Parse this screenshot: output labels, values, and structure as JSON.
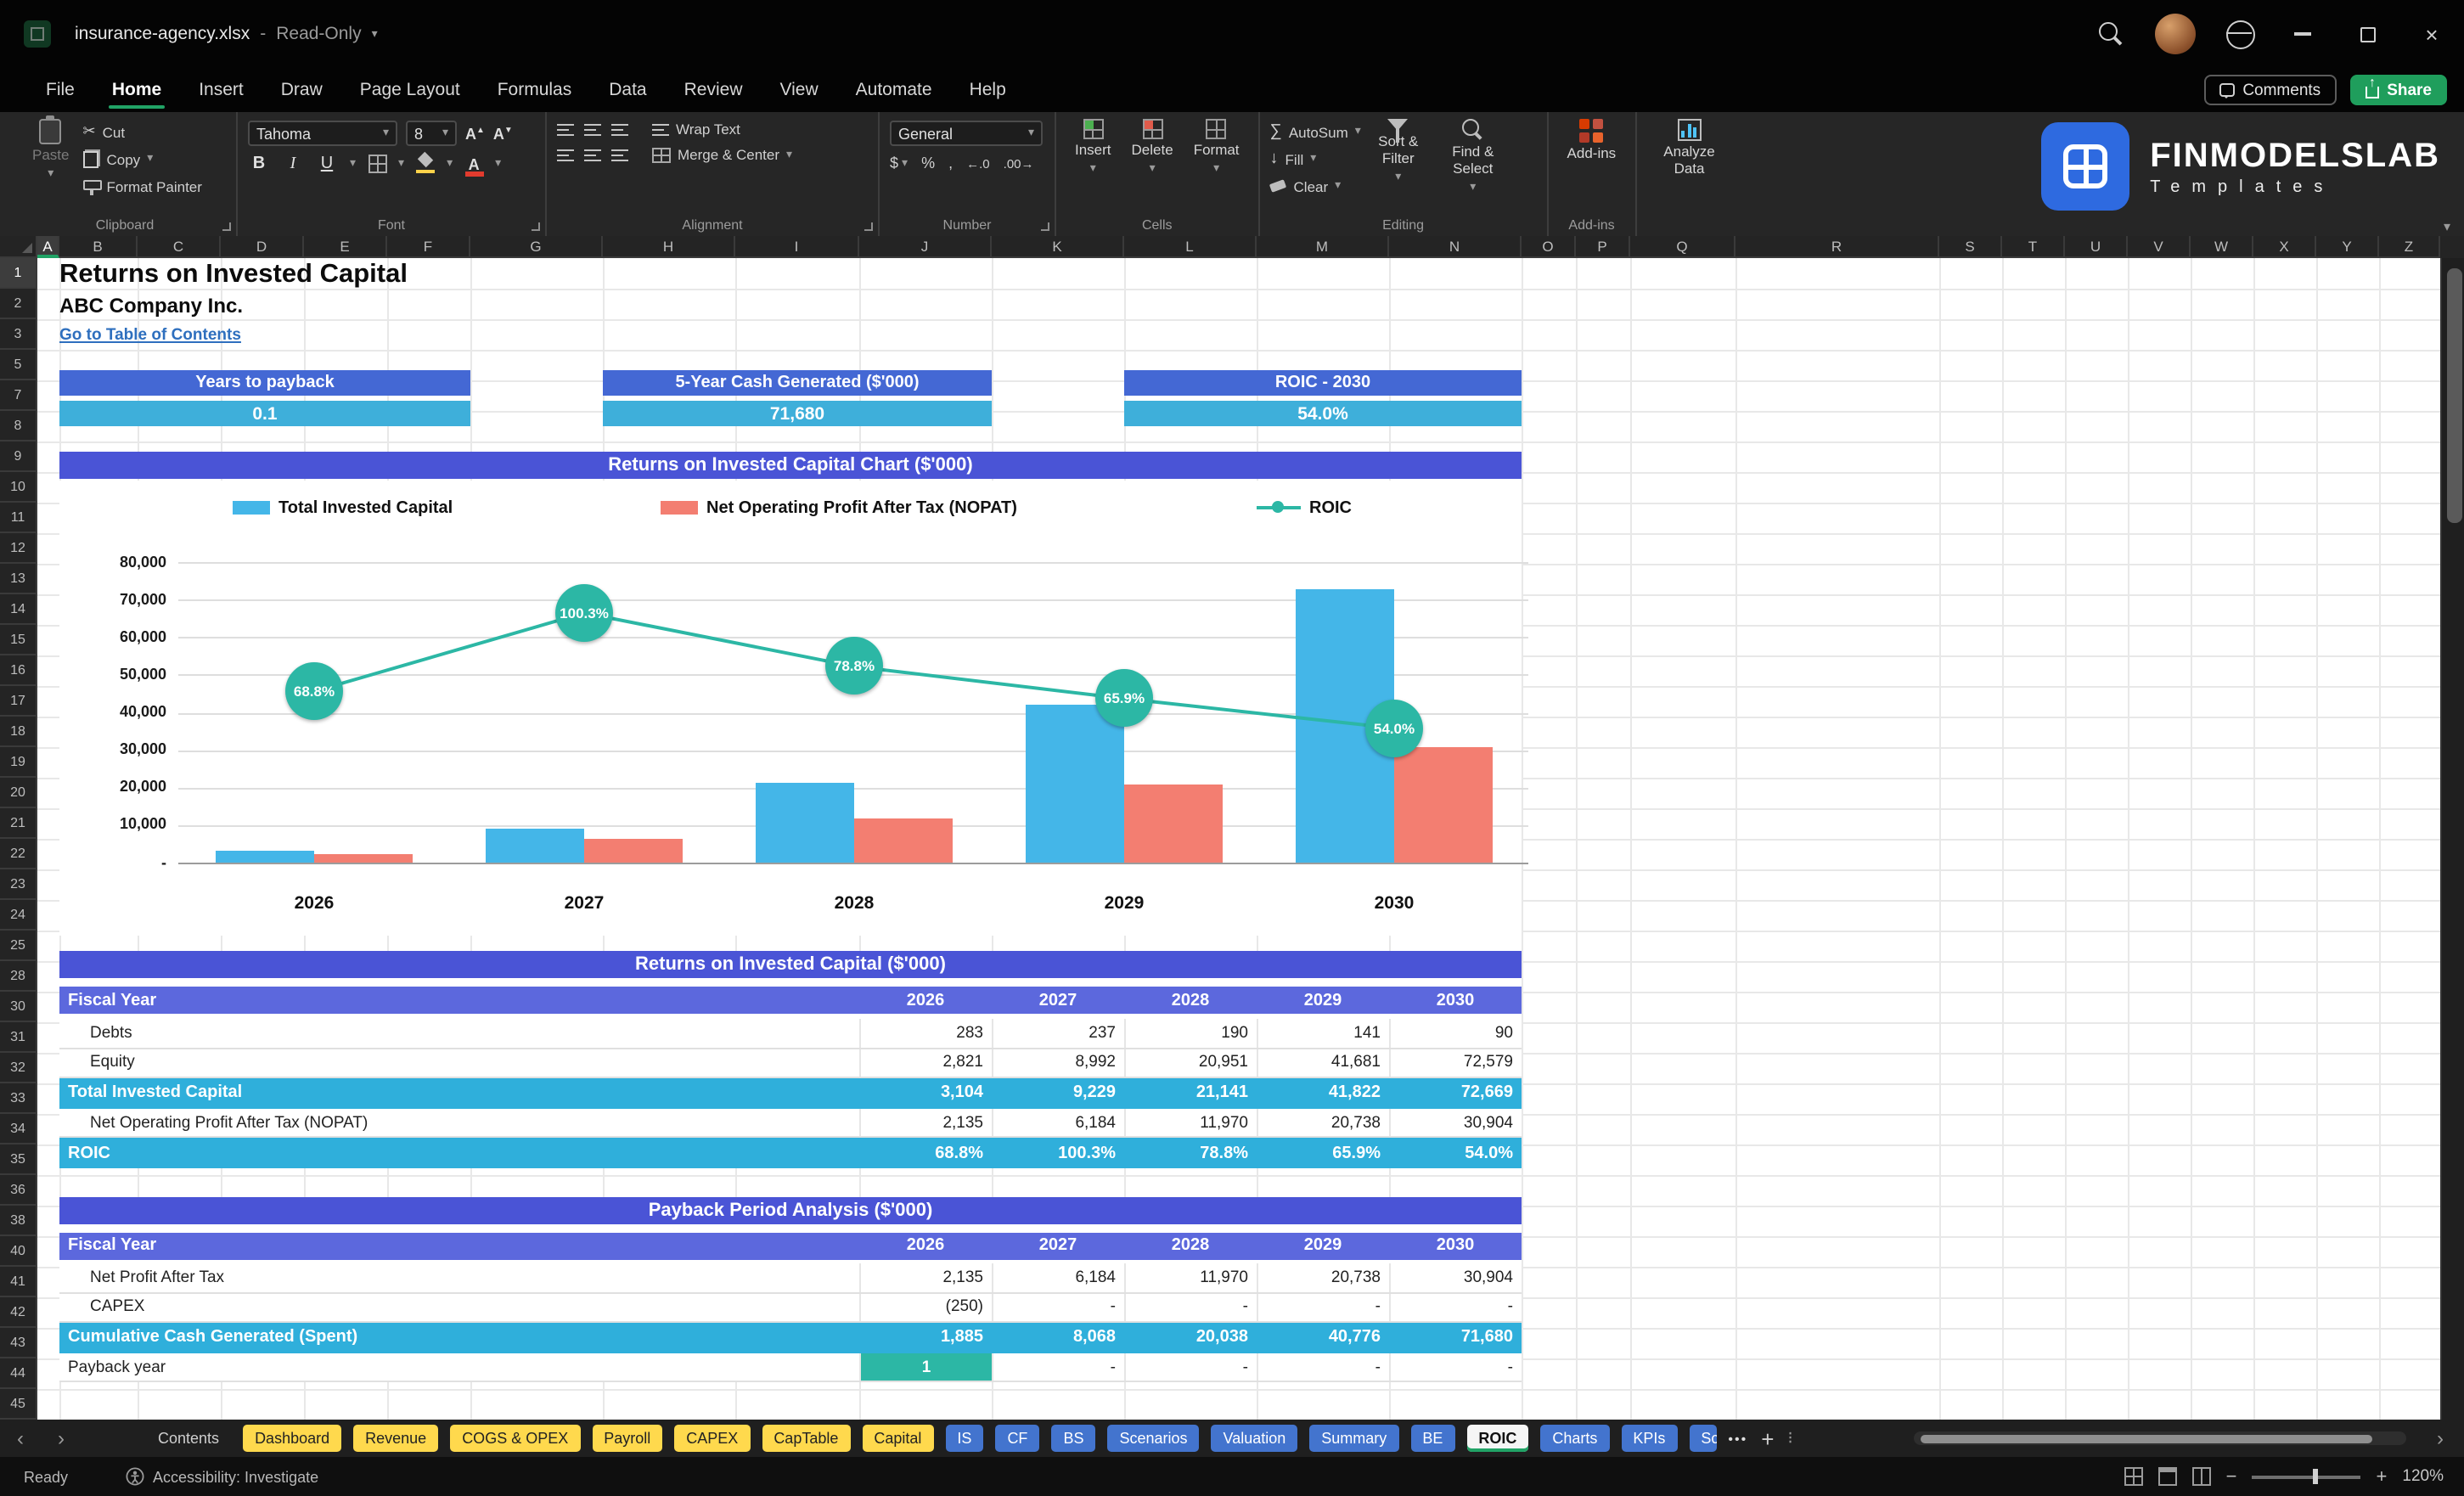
{
  "colors": {
    "accent_green": "#21A366",
    "kpi_header_blue": "#4468D4",
    "kpi_value_cyan": "#3EAFDA",
    "band_indigo": "#4A54D6",
    "fiscal_row_purple": "#5C68DD",
    "highlight_row_cyan": "#2FAFDB",
    "teal": "#2CB7A5",
    "bar_blue": "#44B6E8",
    "bar_salmon": "#F37E71",
    "tab_yellow": "#FFD94D",
    "tab_blue": "#4374CE",
    "share_green": "#1f9e5c"
  },
  "titlebar": {
    "filename": "insurance-agency.xlsx",
    "separator": "-",
    "mode": "Read-Only"
  },
  "menubar": {
    "tabs": [
      "File",
      "Home",
      "Insert",
      "Draw",
      "Page Layout",
      "Formulas",
      "Data",
      "Review",
      "View",
      "Automate",
      "Help"
    ],
    "active_tab": "Home",
    "comments_label": "Comments",
    "share_label": "Share"
  },
  "ribbon": {
    "clipboard": {
      "paste": "Paste",
      "cut": "Cut",
      "copy": "Copy",
      "format_painter": "Format Painter",
      "group": "Clipboard"
    },
    "font": {
      "family": "Tahoma",
      "size": "8",
      "group": "Font"
    },
    "alignment": {
      "wrap_text": "Wrap Text",
      "merge_center": "Merge & Center",
      "group": "Alignment"
    },
    "number": {
      "format": "General",
      "currency": "$",
      "percent": "%",
      "comma": ",",
      "inc_dec": "←.0",
      "dec_dec": ".00→",
      "group": "Number"
    },
    "cells": {
      "insert": "Insert",
      "delete": "Delete",
      "format": "Format",
      "group": "Cells"
    },
    "editing": {
      "autosum": "AutoSum",
      "fill": "Fill",
      "clear": "Clear",
      "sort_filter": "Sort & Filter",
      "find_select": "Find & Select",
      "group": "Editing"
    },
    "addins_label": "Add-ins",
    "analyze_label": "Analyze Data",
    "addins_group": "Add-ins"
  },
  "brand": {
    "name": "FINMODELSLAB",
    "subtitle": "Templates"
  },
  "grid": {
    "columns": [
      "A",
      "B",
      "C",
      "D",
      "E",
      "F",
      "G",
      "H",
      "I",
      "J",
      "K",
      "L",
      "M",
      "N",
      "O",
      "P",
      "Q",
      "R",
      "S",
      "T",
      "U",
      "V",
      "W",
      "X",
      "Y",
      "Z"
    ],
    "rows": [
      "1",
      "2",
      "3",
      "5",
      "7",
      "8",
      "9",
      "10",
      "11",
      "12",
      "13",
      "14",
      "15",
      "16",
      "17",
      "18",
      "19",
      "20",
      "21",
      "22",
      "23",
      "24",
      "25",
      "28",
      "30",
      "31",
      "32",
      "33",
      "34",
      "35",
      "36",
      "38",
      "40",
      "41",
      "42",
      "43",
      "44",
      "45"
    ]
  },
  "sheet": {
    "title": "Returns on Invested Capital",
    "subtitle": "ABC Company Inc.",
    "toc_link": "Go to Table of Contents",
    "kpis": [
      {
        "label": "Years to payback",
        "value": "0.1"
      },
      {
        "label": "5-Year Cash Generated ($'000)",
        "value": "71,680"
      },
      {
        "label": "ROIC - 2030",
        "value": "54.0%"
      }
    ],
    "tables": [
      {
        "title": "Returns on Invested Capital ($'000)",
        "header": {
          "label": "Fiscal Year",
          "years": [
            "2026",
            "2027",
            "2028",
            "2029",
            "2030"
          ]
        },
        "rows": [
          {
            "label": "Debts",
            "values": [
              "283",
              "237",
              "190",
              "141",
              "90"
            ],
            "style": "plain"
          },
          {
            "label": "Equity",
            "values": [
              "2,821",
              "8,992",
              "20,951",
              "41,681",
              "72,579"
            ],
            "style": "plain"
          },
          {
            "label": "Total Invested Capital",
            "values": [
              "3,104",
              "9,229",
              "21,141",
              "41,822",
              "72,669"
            ],
            "style": "highlight"
          },
          {
            "label": "Net Operating Profit After Tax (NOPAT)",
            "values": [
              "2,135",
              "6,184",
              "11,970",
              "20,738",
              "30,904"
            ],
            "style": "plain"
          },
          {
            "label": "ROIC",
            "values": [
              "68.8%",
              "100.3%",
              "78.8%",
              "65.9%",
              "54.0%"
            ],
            "style": "highlight"
          }
        ]
      },
      {
        "title": "Payback Period Analysis ($'000)",
        "header": {
          "label": "Fiscal Year",
          "years": [
            "2026",
            "2027",
            "2028",
            "2029",
            "2030"
          ]
        },
        "rows": [
          {
            "label": "Net Profit After Tax",
            "values": [
              "2,135",
              "6,184",
              "11,970",
              "20,738",
              "30,904"
            ],
            "style": "plain"
          },
          {
            "label": "CAPEX",
            "values": [
              "(250)",
              "-",
              "-",
              "-",
              "-"
            ],
            "style": "plain"
          },
          {
            "label": "Cumulative Cash Generated (Spent)",
            "values": [
              "1,885",
              "8,068",
              "20,038",
              "40,776",
              "71,680"
            ],
            "style": "highlight"
          },
          {
            "label": "Payback year",
            "values": [
              "1",
              "-",
              "-",
              "-",
              "-"
            ],
            "style": "payback"
          }
        ]
      }
    ]
  },
  "chart_data": {
    "type": "combo bar+line",
    "title": "Returns on Invested Capital Chart ($'000)",
    "categories": [
      "2026",
      "2027",
      "2028",
      "2029",
      "2030"
    ],
    "series": [
      {
        "name": "Total Invested Capital",
        "type": "bar",
        "color": "#44B6E8",
        "values": [
          3104,
          9229,
          21141,
          41822,
          72669
        ]
      },
      {
        "name": "Net Operating Profit After Tax (NOPAT)",
        "type": "bar",
        "color": "#F37E71",
        "values": [
          2135,
          6184,
          11970,
          20738,
          30904
        ]
      },
      {
        "name": "ROIC",
        "type": "line",
        "color": "#2CB7A5",
        "values_pct": [
          68.8,
          100.3,
          78.8,
          65.9,
          54.0
        ],
        "labels": [
          "68.8%",
          "100.3%",
          "78.8%",
          "65.9%",
          "54.0%"
        ]
      }
    ],
    "y_axis": {
      "max": 80000,
      "ticks": [
        "80,000",
        "70,000",
        "60,000",
        "50,000",
        "40,000",
        "30,000",
        "20,000",
        "10,000",
        "-"
      ]
    },
    "legend_position": "top",
    "gridlines": true
  },
  "sheet_tabs": [
    {
      "label": "Contents",
      "style": "plain"
    },
    {
      "label": "Dashboard",
      "style": "yellow"
    },
    {
      "label": "Revenue",
      "style": "yellow"
    },
    {
      "label": "COGS & OPEX",
      "style": "yellow"
    },
    {
      "label": "Payroll",
      "style": "yellow"
    },
    {
      "label": "CAPEX",
      "style": "yellow"
    },
    {
      "label": "CapTable",
      "style": "yellow"
    },
    {
      "label": "Capital",
      "style": "yellow"
    },
    {
      "label": "IS",
      "style": "blue"
    },
    {
      "label": "CF",
      "style": "blue"
    },
    {
      "label": "BS",
      "style": "blue"
    },
    {
      "label": "Scenarios",
      "style": "blue"
    },
    {
      "label": "Valuation",
      "style": "blue"
    },
    {
      "label": "Summary",
      "style": "blue"
    },
    {
      "label": "BE",
      "style": "blue"
    },
    {
      "label": "ROIC",
      "style": "active"
    },
    {
      "label": "Charts",
      "style": "blue"
    },
    {
      "label": "KPIs",
      "style": "blue"
    },
    {
      "label": "Sc",
      "style": "blue",
      "clipped": true
    }
  ],
  "active_sheet": "ROIC",
  "statusbar": {
    "ready": "Ready",
    "accessibility": "Accessibility: Investigate",
    "zoom": "120%"
  }
}
